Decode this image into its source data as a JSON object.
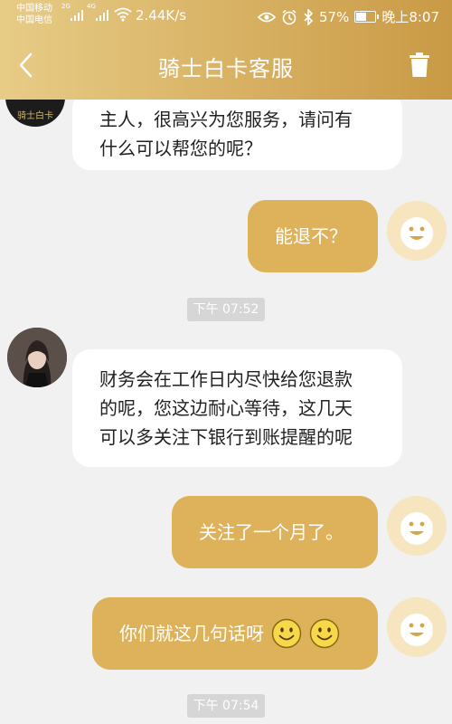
{
  "status_bar": {
    "carrier1": "中国移动",
    "carrier1_net": "2G",
    "carrier2": "中国电信",
    "carrier2_net": "4G",
    "speed": "2.44K/s",
    "battery": "57%",
    "time": "晚上8:07",
    "icons": [
      "wifi-icon",
      "eye-icon",
      "alarm-icon",
      "bluetooth-icon",
      "battery-icon"
    ]
  },
  "header": {
    "title": "骑士白卡客服",
    "back_icon": "chevron-left-icon",
    "delete_icon": "trash-icon"
  },
  "messages": [
    {
      "from": "agent",
      "text_lines": [
        "主人，很高兴为您服务，请问有",
        "什么可以帮您的呢？"
      ],
      "avatar_label": "骑士白卡"
    },
    {
      "from": "user",
      "text": "能退不？"
    },
    {
      "timestamp": "下午 07:52"
    },
    {
      "from": "agent",
      "text_lines": [
        "财务会在工作日内尽快给您退款",
        "的呢，您这边耐心等待，这几天",
        "可以多关注下银行到账提醒的呢"
      ]
    },
    {
      "from": "user",
      "text": "关注了一个月了。"
    },
    {
      "from": "user",
      "text": "你们就这几句话呀",
      "emoji": [
        "smiley-emoji",
        "smiley-emoji"
      ]
    },
    {
      "timestamp": "下午 07:54"
    }
  ],
  "colors": {
    "header_start": "#e7cc86",
    "header_end": "#c99a45",
    "user_bubble": "#deb25a",
    "agent_bubble": "#ffffff",
    "timestamp_bg": "#d6d6d6"
  }
}
